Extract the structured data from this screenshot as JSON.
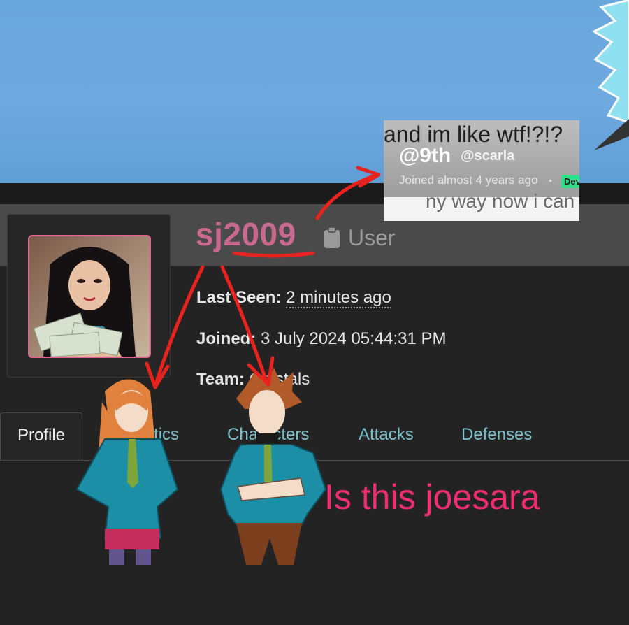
{
  "banner": {
    "background": "#6aa7dc"
  },
  "profile": {
    "username": "sj2009",
    "role_icon": "clipboard-icon",
    "role": "User",
    "last_seen_label": "Last Seen:",
    "last_seen_value": "2 minutes ago",
    "joined_label": "Joined:",
    "joined_value": "3 July 2024 05:44:31 PM",
    "team_label": "Team:",
    "team_value": "Crystals",
    "username_color": "#c9698f"
  },
  "tabs": [
    {
      "label": "Profile",
      "active": true
    },
    {
      "label": "Statistics",
      "active": false
    },
    {
      "label": "Characters",
      "active": false
    },
    {
      "label": "Attacks",
      "active": false
    },
    {
      "label": "Defenses",
      "active": false
    }
  ],
  "inset": {
    "top_text": "and im like wtf!?!?",
    "handle": "@9th",
    "handle2": "@scarla",
    "joined": "Joined almost 4 years ago",
    "separator": "•",
    "badge": "Dev",
    "cut_text": "ny way now i can"
  },
  "annotation": {
    "caption": "Is this joesara",
    "arrow_color": "#e8221d",
    "caption_color": "#ef2d72"
  }
}
